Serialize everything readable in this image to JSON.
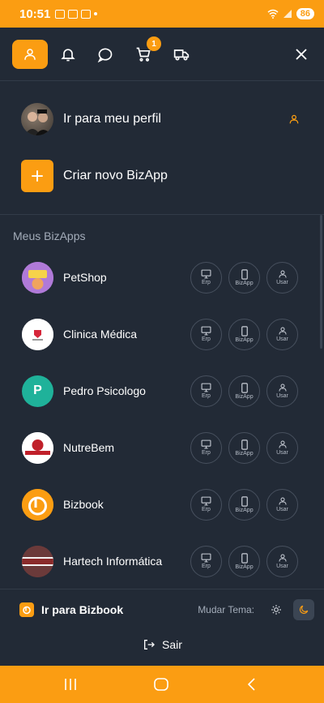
{
  "status": {
    "time": "10:51",
    "battery": "86"
  },
  "nav": {
    "cart_count": "1"
  },
  "menu": {
    "profile_label": "Ir para meu perfil",
    "create_label": "Criar novo BizApp"
  },
  "section_title": "Meus BizApps",
  "action_labels": {
    "erp": "Erp",
    "bizapp": "BizApp",
    "usar": "Usar"
  },
  "bizapps": [
    {
      "name": "PetShop",
      "initial": "",
      "color": "#b07ad8"
    },
    {
      "name": "Clinica Médica",
      "initial": "",
      "color": "#ffffff"
    },
    {
      "name": "Pedro Psicologo",
      "initial": "P",
      "color": "#1fb29a"
    },
    {
      "name": "NutreBem",
      "initial": "",
      "color": "#ffffff"
    },
    {
      "name": "Bizbook",
      "initial": "",
      "color": "#fb9d12"
    },
    {
      "name": "Hartech Informática",
      "initial": "",
      "color": "#6b3a3a"
    }
  ],
  "footer": {
    "bizbook_link": "Ir para Bizbook",
    "theme_label": "Mudar Tema:",
    "logout_label": "Sair"
  },
  "colors": {
    "accent": "#fb9d12",
    "background": "#222a36",
    "border": "#323b48"
  }
}
